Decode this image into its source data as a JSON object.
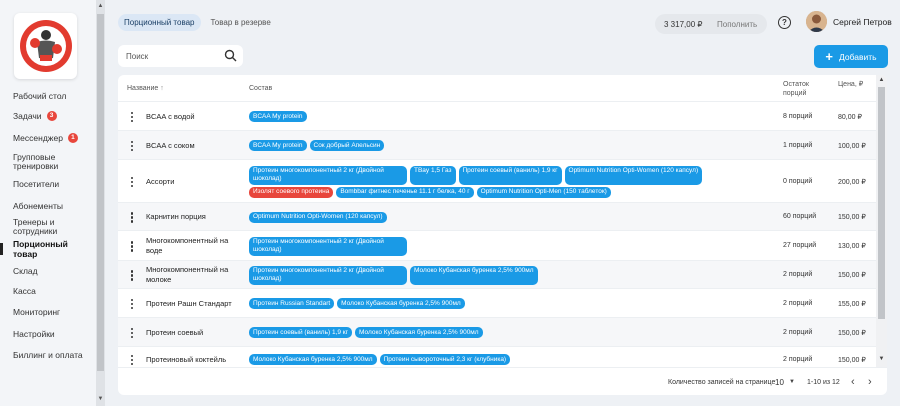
{
  "sidebar": {
    "items": [
      {
        "label": "Рабочий стол",
        "badge": ""
      },
      {
        "label": "Задачи",
        "badge": "3"
      },
      {
        "label": "Мессенджер",
        "badge": "1"
      },
      {
        "label": "Групповые тренировки",
        "badge": ""
      },
      {
        "label": "Посетители",
        "badge": ""
      },
      {
        "label": "Абонементы",
        "badge": ""
      },
      {
        "label": "Тренеры и сотрудники",
        "badge": ""
      },
      {
        "label": "Порционный товар",
        "badge": "",
        "active": true
      },
      {
        "label": "Склад",
        "badge": ""
      },
      {
        "label": "Касса",
        "badge": ""
      },
      {
        "label": "Мониторинг",
        "badge": ""
      },
      {
        "label": "Настройки",
        "badge": ""
      },
      {
        "label": "Биллинг и оплата",
        "badge": ""
      }
    ]
  },
  "tabs": [
    {
      "label": "Порционный товар",
      "active": true
    },
    {
      "label": "Товар в резерве",
      "active": false
    }
  ],
  "balance": {
    "amount": "3 317,00 ₽",
    "topup_label": "Пополнить"
  },
  "help": "?",
  "user": {
    "name": "Сергей Петров"
  },
  "search": {
    "placeholder": "Поиск"
  },
  "add_button": {
    "label": "Добавить"
  },
  "table": {
    "headers": {
      "name": "Название",
      "name_sort": "↑",
      "composition": "Состав",
      "stock": "Остаток порций",
      "price": "Цена, ₽"
    },
    "rows": [
      {
        "name": "BCAA с водой",
        "chips": [
          "BCAA My protein"
        ],
        "stock": "8 порций",
        "price": "80,00 ₽"
      },
      {
        "name": "BCAA с соком",
        "chips": [
          "BCAA My protein",
          "Сок добрый Апельсин"
        ],
        "stock": "1 порций",
        "price": "100,00 ₽"
      },
      {
        "name": "Ассорти",
        "chips": [
          "Протеин многокомпонентный 2 кг (Двойной шоколад)",
          "TBay 1,5 Газ",
          "Протеин соевый (ваниль) 1,9 кг",
          "Optimum Nutrition Opti-Women (120 капсул)",
          "Изолят соевого протеина",
          "Bombbar фитнес печенье 11.1 г белка, 40 г",
          "Optimum Nutrition Opti-Men (150 таблеток)"
        ],
        "red": [
          4
        ],
        "stock": "0 порций",
        "price": "200,00 ₽"
      },
      {
        "name": "Карнитин порция",
        "chips": [
          "Optimum Nutrition Opti-Women (120 капсул)"
        ],
        "stock": "60 порций",
        "price": "150,00 ₽"
      },
      {
        "name": "Многокомпонентный на воде",
        "chips": [
          "Протеин многокомпонентный 2 кг (Двойной шоколад)"
        ],
        "stock": "27 порций",
        "price": "130,00 ₽"
      },
      {
        "name": "Многокомпонентный на молоке",
        "chips": [
          "Протеин многокомпонентный 2 кг (Двойной шоколад)",
          "Молоко Кубанская буренка 2,5% 900мл"
        ],
        "stock": "2 порций",
        "price": "150,00 ₽"
      },
      {
        "name": "Протеин Рашн Стандарт",
        "chips": [
          "Протеин Russian Standart",
          "Молоко Кубанская буренка 2,5% 900мл"
        ],
        "stock": "2 порций",
        "price": "155,00 ₽"
      },
      {
        "name": "Протеин соевый",
        "chips": [
          "Протеин соевый (ваниль) 1,9 кг",
          "Молоко Кубанская буренка 2,5% 900мл"
        ],
        "stock": "2 порций",
        "price": "150,00 ₽"
      },
      {
        "name": "Протеиновый коктейль",
        "chips": [
          "Молоко Кубанская буренка 2,5% 900мл",
          "Протеин сывороточный 2,3 кг (клубника)"
        ],
        "stock": "2 порций",
        "price": "150,00 ₽"
      }
    ]
  },
  "footer": {
    "per_page_label": "Количество записей на странице",
    "page_size": "10",
    "range": "1-10 из 12"
  },
  "colors": {
    "accent": "#1a9ae6",
    "danger": "#e8463c",
    "active_tab_bg": "#dbe7f5"
  },
  "icons": [
    "search-icon",
    "plus-icon",
    "help-icon",
    "kebab-menu-icon",
    "chevron-left-icon",
    "chevron-right-icon",
    "caret-down-icon",
    "sort-up-icon"
  ]
}
